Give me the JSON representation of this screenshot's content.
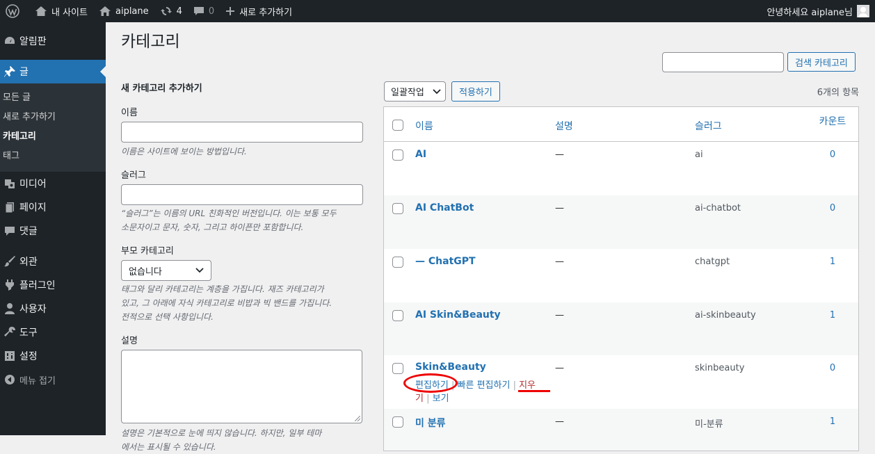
{
  "adminbar": {
    "site_name": "내 사이트",
    "user_site": "aiplane",
    "updates_count": "4",
    "comments_count": "0",
    "new_label": "새로 추가하기",
    "greeting": "안녕하세요 aiplane님"
  },
  "sidebar": {
    "dashboard": "알림판",
    "posts": "글",
    "sub": [
      "모든 글",
      "새로 추가하기",
      "카테고리",
      "태그"
    ],
    "media": "미디어",
    "pages": "페이지",
    "comments": "댓글",
    "appearance": "외관",
    "plugins": "플러그인",
    "users": "사용자",
    "tools": "도구",
    "settings": "설정",
    "collapse": "메뉴 접기"
  },
  "page": {
    "title": "카테고리",
    "search_button": "검색 카테고리",
    "search_value": ""
  },
  "form": {
    "heading": "새 카테고리 추가하기",
    "name_label": "이름",
    "name_help": "이름은 사이트에 보이는 방법입니다.",
    "slug_label": "슬러그",
    "slug_help_1": "“슬러그”는 이름의 URL 친화적인 버전입니다. 이는 보통 모두",
    "slug_help_2": "소문자이고 문자, 숫자, 그리고 하이픈만 포함합니다.",
    "parent_label": "부모 카테고리",
    "parent_value": "없습니다",
    "parent_help_1": "태그와 달리 카테고리는 계층을 가집니다. 재즈 카테고리가",
    "parent_help_2": "있고, 그 아래에 자식 카테고리로 비밥과 빅 밴드를 가집니다.",
    "parent_help_3": "전적으로 선택 사항입니다.",
    "desc_label": "설명",
    "desc_help_1": "설명은 기본적으로 눈에 띄지 않습니다. 하지만, 일부 테마",
    "desc_help_2": "에서는 표시될 수 있습니다."
  },
  "tablenav": {
    "bulk_label": "일괄작업",
    "apply_label": "적용하기",
    "items_count": "6개의 항목"
  },
  "table": {
    "headers": {
      "name": "이름",
      "description": "설명",
      "slug": "슬러그",
      "count": "카운트"
    },
    "rows": [
      {
        "name": "AI",
        "description": "—",
        "slug": "ai",
        "count": "0"
      },
      {
        "name": "AI ChatBot",
        "description": "—",
        "slug": "ai-chatbot",
        "count": "0"
      },
      {
        "name": "— ChatGPT",
        "description": "—",
        "slug": "chatgpt",
        "count": "1"
      },
      {
        "name": "AI Skin&Beauty",
        "description": "—",
        "slug": "ai-skinbeauty",
        "count": "1"
      },
      {
        "name": "Skin&Beauty",
        "description": "—",
        "slug": "skinbeauty",
        "count": "0"
      },
      {
        "name": "미 분류",
        "description": "—",
        "slug": "미-분류",
        "count": "1"
      }
    ],
    "row_actions": {
      "edit": "편집하기",
      "quick_edit": "빠른 편집하기",
      "delete_1": "지우",
      "delete_2": "기",
      "view": "보기"
    }
  },
  "colors": {
    "accent": "#2271b1",
    "adminbar": "#1d2327",
    "annotation": "#ee0000"
  }
}
